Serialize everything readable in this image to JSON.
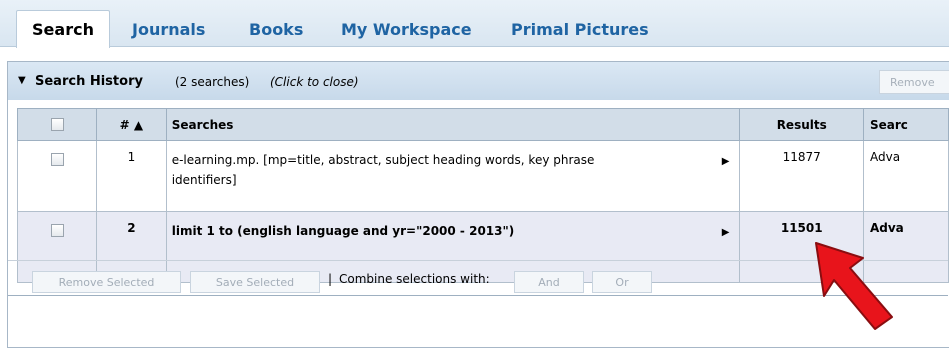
{
  "tabs": [
    "Search",
    "Journals",
    "Books",
    "My Workspace",
    "Primal Pictures"
  ],
  "history": {
    "title": "Search History",
    "count": "(2 searches)",
    "close": "(Click to close)",
    "remove_top": "Remove"
  },
  "table": {
    "headers": {
      "num": "# ▲",
      "searches": "Searches",
      "results": "Results",
      "type": "Searc"
    },
    "rows": [
      {
        "num": "1",
        "search": "e-learning.mp. [mp=title, abstract, subject heading words, key phrase identifiers]",
        "results": "11877",
        "type": "Adva"
      },
      {
        "num": "2",
        "search": "limit 1 to (english language and yr=\"2000 - 2013\")",
        "results": "11501",
        "type": "Adva"
      }
    ]
  },
  "footer": {
    "remove_selected": "Remove Selected",
    "save_selected": "Save Selected",
    "combine_label": "Combine selections with:",
    "and": "And",
    "or": "Or"
  },
  "colors": {
    "tab_text": "#1f64a3",
    "header_bg": "#d2dde8",
    "arrow": "#e8141b"
  }
}
